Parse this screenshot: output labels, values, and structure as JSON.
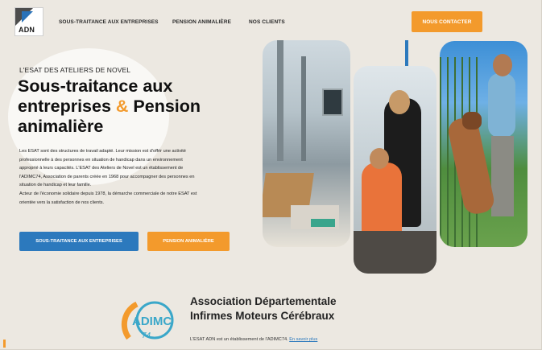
{
  "header": {
    "logo_text": "ADN",
    "nav": [
      "SOUS-TRAITANCE AUX ENTREPRISES",
      "PENSION ANIMALIÈRE",
      "NOS CLIENTS"
    ],
    "contact_label": "NOUS CONTACTER"
  },
  "hero": {
    "eyebrow": "L'ESAT DES ATELIERS DE NOVEL",
    "title_part1": "Sous-traitance aux entreprises",
    "title_amp": "&",
    "title_part2": "Pension animalière",
    "description_lines": [
      "Les ESAT sont des structures de travail adapté. Leur mission est d'offrir une activité",
      "professionnelle à des personnes en situation de handicap dans un environnement",
      "approprié à leurs capacités. L'ESAT des Ateliers de Novel est un établissement de",
      "l'ADIMC74, Association de parents créée en 1968 pour accompagner des personnes en",
      "situation de handicap et leur famille.",
      "Acteur de l'économie solidaire depuis 1978, la démarche commerciale de notre ESAT est",
      "orientée vers la satisfaction de nos clients."
    ],
    "button_primary": "SOUS-TRAITANCE AUX ENTREPRISES",
    "button_secondary": "PENSION ANIMALIÈRE"
  },
  "association": {
    "logo_text": "ADIMC",
    "logo_number": "74",
    "name_line1": "Association Départementale",
    "name_line2": "Infirmes Moteurs Cérébraux",
    "note": "L'ESAT ADN est un établissement de l'ADIMC74.",
    "link": "En savoir plus"
  },
  "colors": {
    "accent_orange": "#f39a2c",
    "accent_blue": "#2c79bd",
    "background": "#ece8e1"
  }
}
